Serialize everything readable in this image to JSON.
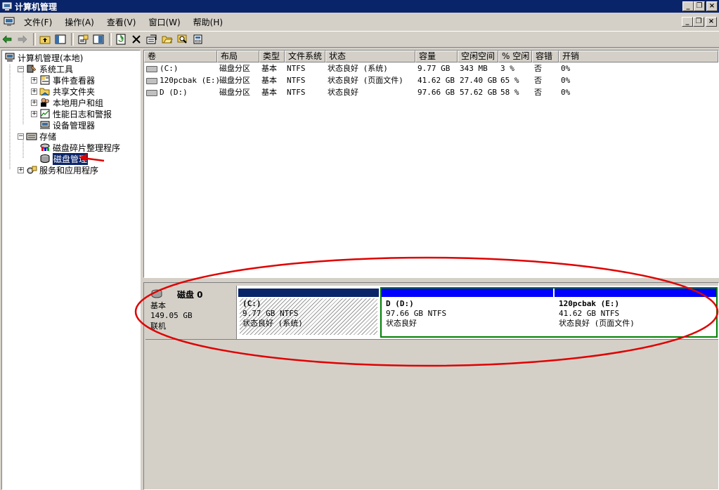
{
  "window": {
    "title": "计算机管理"
  },
  "menu": [
    {
      "label": "文件(F)"
    },
    {
      "label": "操作(A)"
    },
    {
      "label": "查看(V)"
    },
    {
      "label": "窗口(W)"
    },
    {
      "label": "帮助(H)"
    }
  ],
  "tree": [
    {
      "label": "计算机管理(本地)",
      "indent": 0,
      "expander": "",
      "icon": "computer-icon"
    },
    {
      "label": "系统工具",
      "indent": 1,
      "expander": "−",
      "icon": "tools-icon"
    },
    {
      "label": "事件查看器",
      "indent": 2,
      "expander": "+",
      "icon": "event-viewer-icon"
    },
    {
      "label": "共享文件夹",
      "indent": 2,
      "expander": "+",
      "icon": "shared-folder-icon"
    },
    {
      "label": "本地用户和组",
      "indent": 2,
      "expander": "+",
      "icon": "users-icon"
    },
    {
      "label": "性能日志和警报",
      "indent": 2,
      "expander": "+",
      "icon": "performance-icon"
    },
    {
      "label": "设备管理器",
      "indent": 2,
      "expander": "",
      "icon": "device-manager-icon"
    },
    {
      "label": "存储",
      "indent": 1,
      "expander": "−",
      "icon": "storage-icon"
    },
    {
      "label": "磁盘碎片整理程序",
      "indent": 2,
      "expander": "",
      "icon": "defrag-icon"
    },
    {
      "label": "磁盘管理",
      "indent": 2,
      "expander": "",
      "icon": "disk-management-icon",
      "selected": true
    },
    {
      "label": "服务和应用程序",
      "indent": 1,
      "expander": "+",
      "icon": "services-icon"
    }
  ],
  "list": {
    "columns": [
      "卷",
      "布局",
      "类型",
      "文件系统",
      "状态",
      "容量",
      "空闲空间",
      "% 空闲",
      "容错",
      "开销"
    ],
    "rows": [
      [
        "(C:)",
        "磁盘分区",
        "基本",
        "NTFS",
        "状态良好 (系统)",
        "9.77 GB",
        "343 MB",
        "3 %",
        "否",
        "0%"
      ],
      [
        "120pcbak (E:)",
        "磁盘分区",
        "基本",
        "NTFS",
        "状态良好 (页面文件)",
        "41.62 GB",
        "27.40 GB",
        "65 %",
        "否",
        "0%"
      ],
      [
        "D (D:)",
        "磁盘分区",
        "基本",
        "NTFS",
        "状态良好",
        "97.66 GB",
        "57.62 GB",
        "58 %",
        "否",
        "0%"
      ]
    ]
  },
  "disk": {
    "name": "磁盘 0",
    "type": "基本",
    "size": "149.05 GB",
    "status": "联机",
    "partitions": [
      {
        "title": "(C:)",
        "size": "9.77 GB NTFS",
        "status": "状态良好 (系统)",
        "bar_color": "#0a246a"
      },
      {
        "title": "D   (D:)",
        "size": "97.66 GB NTFS",
        "status": "状态良好",
        "bar_color": "#0000ff"
      },
      {
        "title": "120pcbak  (E:)",
        "size": "41.62 GB NTFS",
        "status": "状态良好 (页面文件)",
        "bar_color": "#0000ff"
      }
    ]
  },
  "colors": {
    "titlebar": "#0a246a",
    "annotation": "#e00000",
    "extended": "#008000"
  }
}
